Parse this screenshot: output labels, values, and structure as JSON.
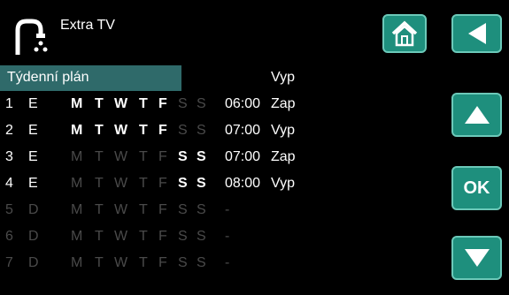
{
  "window": {
    "title": "Extra TV"
  },
  "icons": {
    "app": "faucet-hot-water-icon",
    "home": "home-icon",
    "back": "back-arrow-icon",
    "up": "up-arrow-icon",
    "down": "down-arrow-icon"
  },
  "buttons": {
    "ok_label": "OK"
  },
  "colors": {
    "button_bg": "#1e8f7d",
    "button_border": "#6cc9b9",
    "header_bg": "#2f6a6a",
    "inactive": "#4a4a4a"
  },
  "schedule": {
    "header_label": "Týdenní plán",
    "header_status": "Vyp",
    "day_letters": [
      "M",
      "T",
      "W",
      "T",
      "F",
      "S",
      "S"
    ],
    "rows": [
      {
        "num": "1",
        "mode": "E",
        "days": [
          true,
          true,
          true,
          true,
          true,
          false,
          false
        ],
        "time": "06:00",
        "status": "Zap",
        "enabled": true
      },
      {
        "num": "2",
        "mode": "E",
        "days": [
          true,
          true,
          true,
          true,
          true,
          false,
          false
        ],
        "time": "07:00",
        "status": "Vyp",
        "enabled": true
      },
      {
        "num": "3",
        "mode": "E",
        "days": [
          false,
          false,
          false,
          false,
          false,
          true,
          true
        ],
        "time": "07:00",
        "status": "Zap",
        "enabled": true
      },
      {
        "num": "4",
        "mode": "E",
        "days": [
          false,
          false,
          false,
          false,
          false,
          true,
          true
        ],
        "time": "08:00",
        "status": "Vyp",
        "enabled": true
      },
      {
        "num": "5",
        "mode": "D",
        "days": [
          false,
          false,
          false,
          false,
          false,
          false,
          false
        ],
        "time": "-",
        "status": "",
        "enabled": false
      },
      {
        "num": "6",
        "mode": "D",
        "days": [
          false,
          false,
          false,
          false,
          false,
          false,
          false
        ],
        "time": "-",
        "status": "",
        "enabled": false
      },
      {
        "num": "7",
        "mode": "D",
        "days": [
          false,
          false,
          false,
          false,
          false,
          false,
          false
        ],
        "time": "-",
        "status": "",
        "enabled": false
      }
    ]
  }
}
